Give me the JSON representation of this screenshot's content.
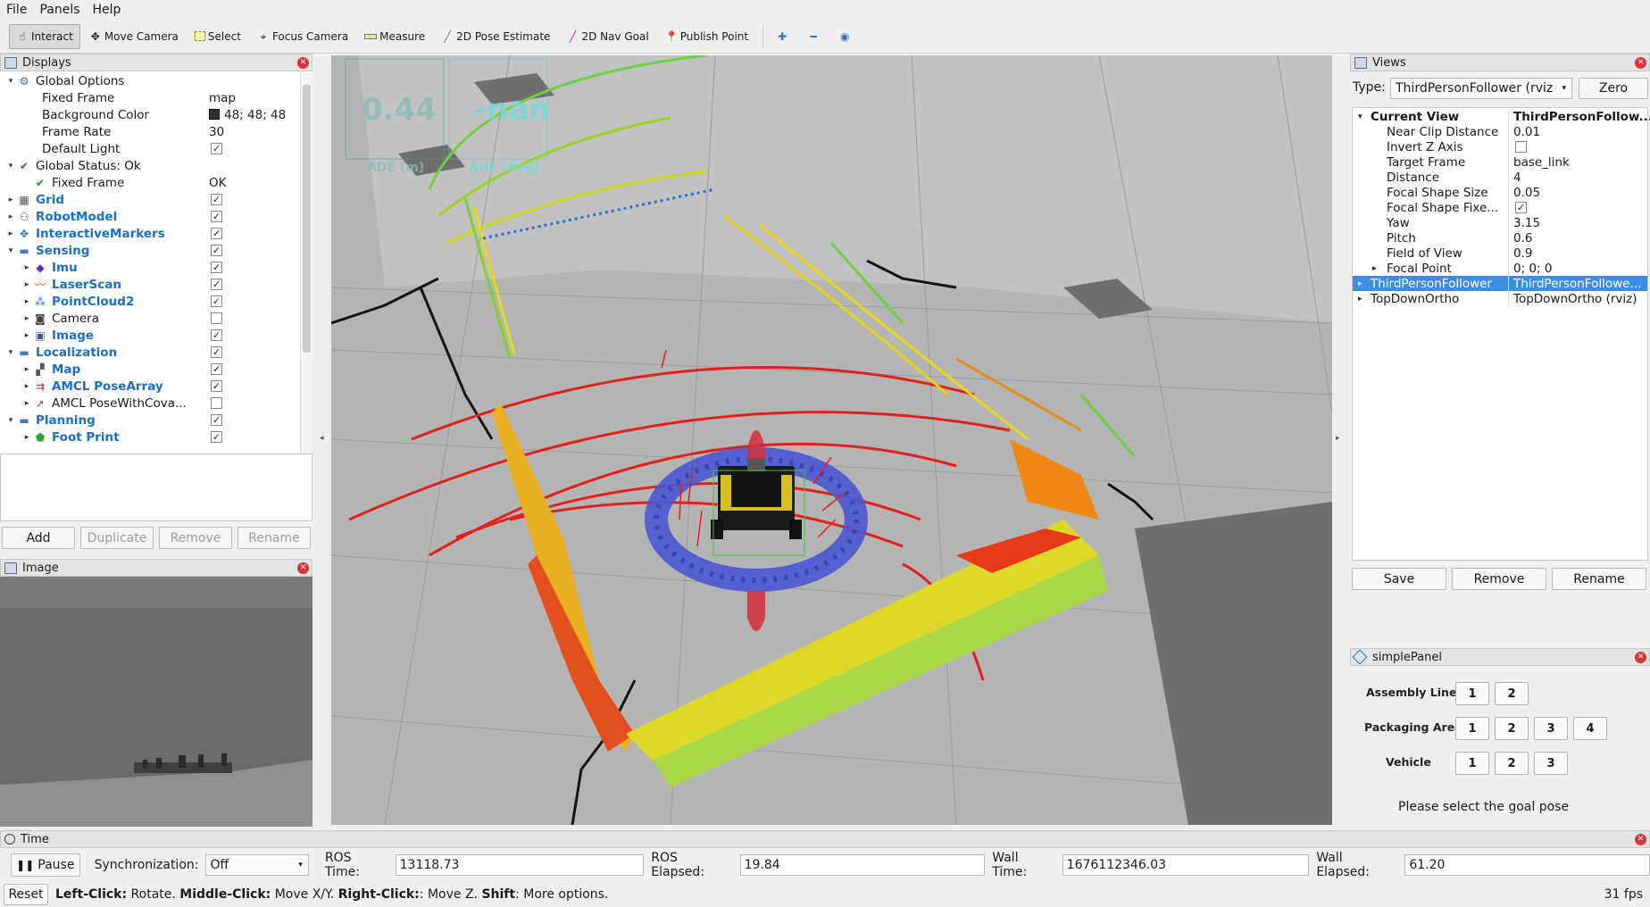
{
  "menu": [
    "File",
    "Panels",
    "Help"
  ],
  "toolbar": [
    {
      "label": "Interact",
      "icon": "interact-icon",
      "active": true
    },
    {
      "label": "Move Camera",
      "icon": "move-camera-icon"
    },
    {
      "label": "Select",
      "icon": "select-icon"
    },
    {
      "label": "Focus Camera",
      "icon": "focus-camera-icon"
    },
    {
      "label": "Measure",
      "icon": "measure-icon"
    },
    {
      "label": "2D Pose Estimate",
      "icon": "pose-estimate-icon"
    },
    {
      "label": "2D Nav Goal",
      "icon": "nav-goal-icon"
    },
    {
      "label": "Publish Point",
      "icon": "publish-point-icon"
    }
  ],
  "displays": {
    "title": "Displays",
    "rows": [
      {
        "indent": 0,
        "arrow": "▾",
        "icon": "global-options-icon",
        "label": "Global Options",
        "style": "normal"
      },
      {
        "indent": 1,
        "arrow": "",
        "icon": "",
        "label": "Fixed Frame",
        "value": "map"
      },
      {
        "indent": 1,
        "arrow": "",
        "icon": "",
        "label": "Background Color",
        "value": "48; 48; 48",
        "swatch": "#303030"
      },
      {
        "indent": 1,
        "arrow": "",
        "icon": "",
        "label": "Frame Rate",
        "value": "30"
      },
      {
        "indent": 1,
        "arrow": "",
        "icon": "",
        "label": "Default Light",
        "check": true
      },
      {
        "indent": 0,
        "arrow": "▾",
        "icon": "ok-check-icon",
        "label": "Global Status: Ok"
      },
      {
        "indent": 1,
        "arrow": "",
        "icon": "ok-check-icon",
        "label": "Fixed Frame",
        "value": "OK"
      },
      {
        "indent": 0,
        "arrow": "▸",
        "icon": "grid-icon",
        "label": "Grid",
        "style": "blue",
        "check": true
      },
      {
        "indent": 0,
        "arrow": "▸",
        "icon": "robot-model-icon",
        "label": "RobotModel",
        "style": "blue",
        "check": true
      },
      {
        "indent": 0,
        "arrow": "▸",
        "icon": "interactive-markers-icon",
        "label": "InteractiveMarkers",
        "style": "blue",
        "check": true
      },
      {
        "indent": 0,
        "arrow": "▾",
        "icon": "folder-icon",
        "label": "Sensing",
        "style": "blue",
        "check": true
      },
      {
        "indent": 1,
        "arrow": "▸",
        "icon": "imu-icon",
        "label": "Imu",
        "style": "blue",
        "check": true
      },
      {
        "indent": 1,
        "arrow": "▸",
        "icon": "laser-scan-icon",
        "label": "LaserScan",
        "style": "blue",
        "check": true
      },
      {
        "indent": 1,
        "arrow": "▸",
        "icon": "point-cloud-icon",
        "label": "PointCloud2",
        "style": "blue",
        "check": true
      },
      {
        "indent": 1,
        "arrow": "▸",
        "icon": "camera-icon",
        "label": "Camera",
        "check": false
      },
      {
        "indent": 1,
        "arrow": "▸",
        "icon": "image-icon",
        "label": "Image",
        "style": "blue",
        "check": true
      },
      {
        "indent": 0,
        "arrow": "▾",
        "icon": "folder-icon",
        "label": "Localization",
        "style": "blue",
        "check": true
      },
      {
        "indent": 1,
        "arrow": "▸",
        "icon": "map-icon",
        "label": "Map",
        "style": "blue",
        "check": true
      },
      {
        "indent": 1,
        "arrow": "▸",
        "icon": "pose-array-icon",
        "label": "AMCL PoseArray",
        "style": "blue",
        "check": true
      },
      {
        "indent": 1,
        "arrow": "▸",
        "icon": "pose-covariance-icon",
        "label": "AMCL PoseWithCova...",
        "check": false
      },
      {
        "indent": 0,
        "arrow": "▾",
        "icon": "folder-icon",
        "label": "Planning",
        "style": "blue",
        "check": true
      },
      {
        "indent": 1,
        "arrow": "▸",
        "icon": "footprint-icon",
        "label": "Foot Print",
        "style": "blue",
        "check": true
      }
    ],
    "buttons": [
      "Add",
      "Duplicate",
      "Remove",
      "Rename"
    ]
  },
  "image_panel": {
    "title": "Image"
  },
  "overlay": {
    "ade_value": "0.44",
    "ade_label": "ADE (m)",
    "ahe_value": "-nan",
    "ahe_label": "AHE (deg)"
  },
  "views": {
    "title": "Views",
    "type_label": "Type:",
    "type_value": "ThirdPersonFollower (rviz",
    "zero_label": "Zero",
    "rows": [
      {
        "indent": 0,
        "arrow": "▾",
        "label": "Current View",
        "value": "ThirdPersonFollow...",
        "bold": true
      },
      {
        "indent": 1,
        "label": "Near Clip Distance",
        "value": "0.01"
      },
      {
        "indent": 1,
        "label": "Invert Z Axis",
        "check": false
      },
      {
        "indent": 1,
        "label": "Target Frame",
        "value": "base_link"
      },
      {
        "indent": 1,
        "label": "Distance",
        "value": "4"
      },
      {
        "indent": 1,
        "label": "Focal Shape Size",
        "value": "0.05"
      },
      {
        "indent": 1,
        "label": "Focal Shape Fixe...",
        "check": true
      },
      {
        "indent": 1,
        "label": "Yaw",
        "value": "3.15"
      },
      {
        "indent": 1,
        "label": "Pitch",
        "value": "0.6"
      },
      {
        "indent": 1,
        "label": "Field of View",
        "value": "0.9"
      },
      {
        "indent": 1,
        "arrow": "▸",
        "label": "Focal Point",
        "value": "0; 0; 0"
      },
      {
        "indent": 0,
        "arrow": "▸",
        "label": "ThirdPersonFollower",
        "value": "ThirdPersonFollowe...",
        "selected": true
      },
      {
        "indent": 0,
        "arrow": "▸",
        "label": "TopDownOrtho",
        "value": "TopDownOrtho (rviz)"
      }
    ],
    "buttons": [
      "Save",
      "Remove",
      "Rename"
    ]
  },
  "simple_panel": {
    "title": "simplePanel",
    "groups": [
      {
        "label": "Assembly Line",
        "buttons": [
          "1",
          "2"
        ]
      },
      {
        "label": "Packaging Area",
        "buttons": [
          "1",
          "2",
          "3",
          "4"
        ]
      },
      {
        "label": "Vehicle",
        "buttons": [
          "1",
          "2",
          "3"
        ]
      }
    ],
    "message": "Please select the goal pose"
  },
  "time": {
    "title": "Time",
    "pause_label": "Pause",
    "sync_label": "Synchronization:",
    "sync_value": "Off",
    "ros_time_label": "ROS Time:",
    "ros_time": "13118.73",
    "ros_elapsed_label": "ROS Elapsed:",
    "ros_elapsed": "19.84",
    "wall_time_label": "Wall Time:",
    "wall_time": "1676112346.03",
    "wall_elapsed_label": "Wall Elapsed:",
    "wall_elapsed": "61.20"
  },
  "status": {
    "reset_label": "Reset",
    "help_parts": [
      {
        "text": "Left-Click:",
        "bold": true
      },
      {
        "text": " Rotate. ",
        "bold": false
      },
      {
        "text": "Middle-Click:",
        "bold": true
      },
      {
        "text": " Move X/Y. ",
        "bold": false
      },
      {
        "text": "Right-Click:",
        "bold": true
      },
      {
        "text": ": Move Z. ",
        "bold": false
      },
      {
        "text": "Shift",
        "bold": true
      },
      {
        "text": ": More options.",
        "bold": false
      }
    ],
    "fps": "31 fps"
  },
  "colors": {
    "accent": "#1a6fc4",
    "selection": "#3d8ee0",
    "close": "#d8353d"
  }
}
